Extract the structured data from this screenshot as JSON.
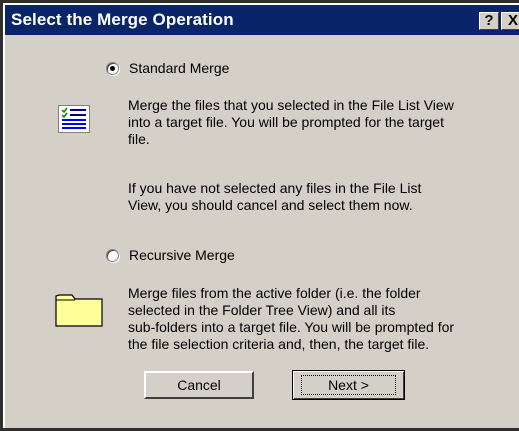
{
  "dialog": {
    "title": "Select the Merge Operation",
    "help_button": "?",
    "close_button": "X"
  },
  "standard": {
    "label": "Standard Merge",
    "selected": true,
    "icon": "file-list-icon",
    "description": "Merge the files that you selected in the File List View\ninto a target file.  You will be prompted for the target\nfile.",
    "note": "If you have not selected any files in the File List\nView, you should cancel and select them now."
  },
  "recursive": {
    "label": "Recursive Merge",
    "selected": false,
    "icon": "folder-icon",
    "description": "Merge files from the active folder (i.e. the folder\nselected in the Folder Tree View) and all its\nsub-folders into a target file.  You will be prompted for\nthe file selection criteria and, then, the target file."
  },
  "buttons": {
    "cancel": "Cancel",
    "next": "Next >"
  },
  "colors": {
    "titlebar": "#0a246a",
    "dialog_bg": "#d4d0c8",
    "folder": "#ffff99"
  }
}
